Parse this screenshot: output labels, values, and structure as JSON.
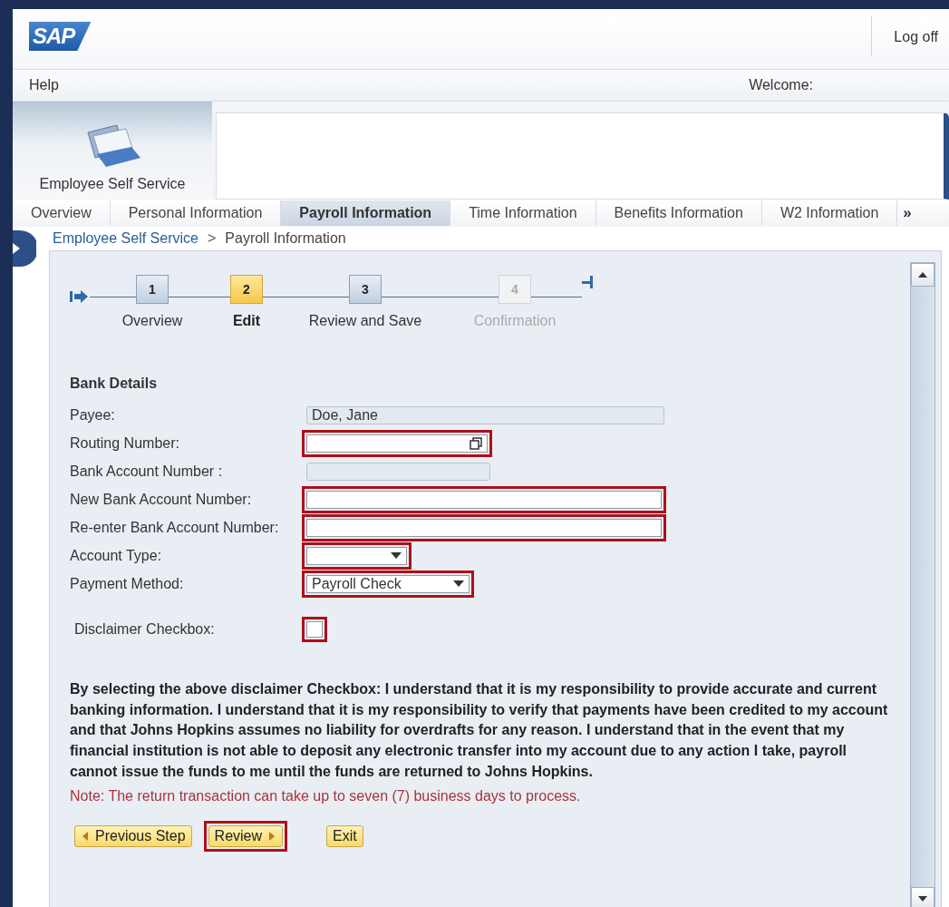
{
  "header": {
    "logo": "SAP",
    "logoff": "Log off"
  },
  "menu": {
    "help": "Help",
    "welcome": "Welcome:"
  },
  "workset": {
    "label": "Employee Self Service"
  },
  "tabs": [
    {
      "label": "Overview",
      "selected": false
    },
    {
      "label": "Personal Information",
      "selected": false
    },
    {
      "label": "Payroll Information",
      "selected": true
    },
    {
      "label": "Time Information",
      "selected": false
    },
    {
      "label": "Benefits Information",
      "selected": false
    },
    {
      "label": "W2 Information",
      "selected": false
    }
  ],
  "more_tabs": "»",
  "breadcrumb": [
    {
      "label": "Employee Self Service"
    },
    {
      "label": "Payroll Information"
    }
  ],
  "breadcrumb_separator": ">",
  "steps": [
    {
      "number": "1",
      "label": "Overview",
      "selected": false,
      "disabled": false
    },
    {
      "number": "2",
      "label": "Edit",
      "selected": true,
      "disabled": false
    },
    {
      "number": "3",
      "label": "Review and Save",
      "selected": false,
      "disabled": false
    },
    {
      "number": "4",
      "label": "Confirmation",
      "selected": false,
      "disabled": true
    }
  ],
  "section_title": "Bank Details",
  "fields": [
    {
      "label": "Payee:",
      "kind": "display",
      "value": "Doe, Jane",
      "highlighted": false
    },
    {
      "label": "Routing Number:",
      "kind": "lookup",
      "highlighted": true
    },
    {
      "label": "Bank Account Number :",
      "kind": "display",
      "highlighted": false
    },
    {
      "label": "New Bank Account Number:",
      "kind": "input",
      "highlighted": true
    },
    {
      "label": "Re-enter Bank Account Number:",
      "kind": "input",
      "highlighted": true
    },
    {
      "label": "Account Type:",
      "kind": "dropdown",
      "highlighted": true
    },
    {
      "label": "Payment Method:",
      "kind": "dropdown",
      "value": "Payroll Check",
      "highlighted": true
    },
    {
      "label": "Disclaimer Checkbox:",
      "kind": "checkbox",
      "checked": false,
      "highlighted": true
    }
  ],
  "disclaimer": "By selecting the above disclaimer Checkbox: I understand that it is my responsibility to provide accurate and current banking information. I understand that it is my responsibility to verify that payments have been credited to my account and that Johns Hopkins assumes no liability for overdrafts for any reason. I understand that in the event that my financial institution is not able to deposit any electronic transfer into my account due to any action I take, payroll cannot issue the funds to me until the funds are returned to Johns Hopkins.",
  "note": "Note: The return transaction can take up to seven (7) business days to process.",
  "buttons": [
    {
      "label": "Previous Step",
      "kind": "back",
      "highlighted": false
    },
    {
      "label": "Review",
      "kind": "next",
      "highlighted": true
    },
    {
      "label": "Exit",
      "kind": "plain",
      "highlighted": false
    }
  ]
}
